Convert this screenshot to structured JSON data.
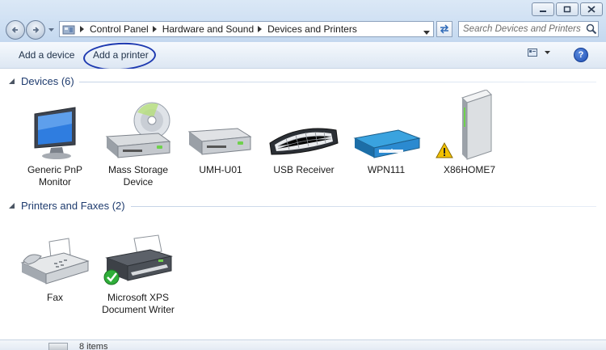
{
  "window": {
    "minimize_glyph": "—",
    "maximize_glyph": "▢",
    "close_glyph": "✕"
  },
  "address": {
    "crumbs": [
      "Control Panel",
      "Hardware and Sound",
      "Devices and Printers"
    ],
    "search_placeholder": "Search Devices and Printers"
  },
  "commands": {
    "add_device": "Add a device",
    "add_printer": "Add a printer",
    "help": "?"
  },
  "groups": {
    "devices": {
      "label": "Devices (6)",
      "items": [
        {
          "label": "Generic PnP Monitor",
          "icon": "monitor-icon"
        },
        {
          "label": "Mass Storage Device",
          "icon": "mass-storage-icon"
        },
        {
          "label": "UMH-U01",
          "icon": "drive-icon"
        },
        {
          "label": "USB Receiver",
          "icon": "keyboard-icon"
        },
        {
          "label": "WPN111",
          "icon": "router-icon"
        },
        {
          "label": "X86HOME7",
          "icon": "computer-tower-icon",
          "warning": true
        }
      ]
    },
    "printers": {
      "label": "Printers and Faxes (2)",
      "items": [
        {
          "label": "Fax",
          "icon": "fax-icon"
        },
        {
          "label": "Microsoft XPS Document Writer",
          "icon": "printer-icon",
          "default": true
        }
      ]
    }
  },
  "status": {
    "text": "8 items"
  },
  "colors": {
    "accent": "#1e3b6e",
    "annotation_circle": "#1e3ab0",
    "chrome": "#cfe0f3"
  }
}
